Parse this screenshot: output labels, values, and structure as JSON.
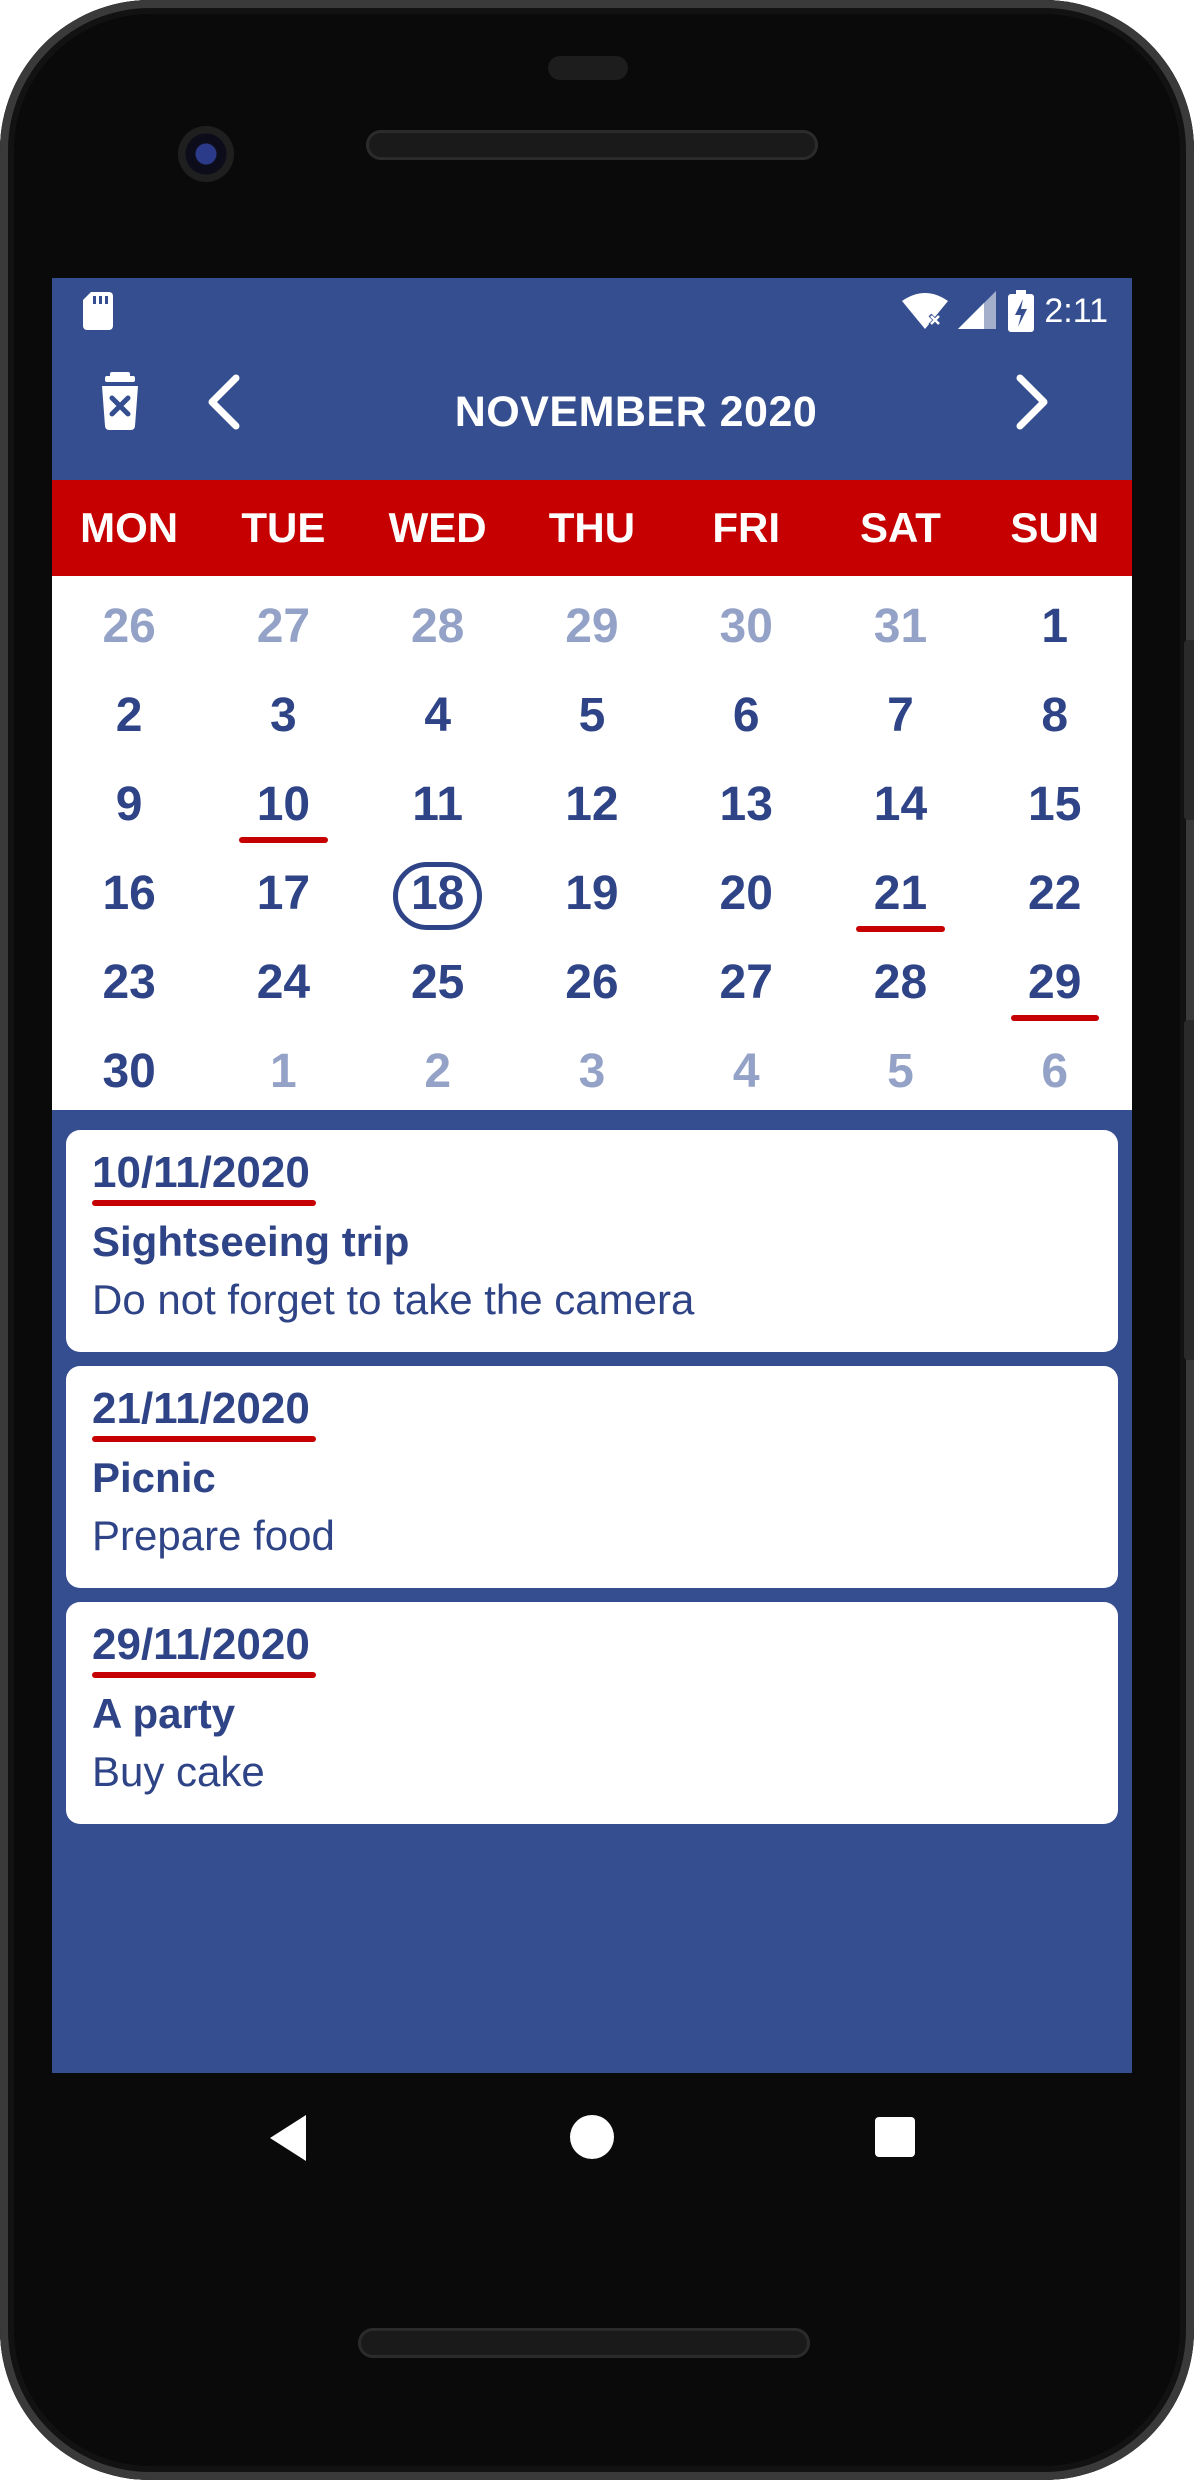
{
  "status_bar": {
    "time": "2:11",
    "icons": [
      "sd-card-icon",
      "wifi-icon",
      "signal-icon",
      "battery-charging-icon"
    ]
  },
  "app_bar": {
    "title": "NOVEMBER 2020",
    "icons": {
      "delete": "delete-icon",
      "prev": "chevron-left-icon",
      "next": "chevron-right-icon"
    }
  },
  "calendar": {
    "weekdays": [
      "MON",
      "TUE",
      "WED",
      "THU",
      "FRI",
      "SAT",
      "SUN"
    ],
    "weeks": [
      [
        {
          "day": "26",
          "other": true
        },
        {
          "day": "27",
          "other": true
        },
        {
          "day": "28",
          "other": true
        },
        {
          "day": "29",
          "other": true
        },
        {
          "day": "30",
          "other": true
        },
        {
          "day": "31",
          "other": true
        },
        {
          "day": "1"
        }
      ],
      [
        {
          "day": "2"
        },
        {
          "day": "3"
        },
        {
          "day": "4"
        },
        {
          "day": "5"
        },
        {
          "day": "6"
        },
        {
          "day": "7"
        },
        {
          "day": "8"
        }
      ],
      [
        {
          "day": "9"
        },
        {
          "day": "10",
          "event": true
        },
        {
          "day": "11"
        },
        {
          "day": "12"
        },
        {
          "day": "13"
        },
        {
          "day": "14"
        },
        {
          "day": "15"
        }
      ],
      [
        {
          "day": "16"
        },
        {
          "day": "17"
        },
        {
          "day": "18",
          "today": true
        },
        {
          "day": "19"
        },
        {
          "day": "20"
        },
        {
          "day": "21",
          "event": true
        },
        {
          "day": "22"
        }
      ],
      [
        {
          "day": "23"
        },
        {
          "day": "24"
        },
        {
          "day": "25"
        },
        {
          "day": "26"
        },
        {
          "day": "27"
        },
        {
          "day": "28"
        },
        {
          "day": "29",
          "event": true
        }
      ],
      [
        {
          "day": "30"
        },
        {
          "day": "1",
          "other": true
        },
        {
          "day": "2",
          "other": true
        },
        {
          "day": "3",
          "other": true
        },
        {
          "day": "4",
          "other": true
        },
        {
          "day": "5",
          "other": true
        },
        {
          "day": "6",
          "other": true
        }
      ]
    ]
  },
  "events": [
    {
      "date": "10/11/2020",
      "title": "Sightseeing trip",
      "description": "Do not forget to take the camera"
    },
    {
      "date": "21/11/2020",
      "title": "Picnic",
      "description": "Prepare food"
    },
    {
      "date": "29/11/2020",
      "title": "A party",
      "description": "Buy cake"
    }
  ],
  "nav_bar": {
    "icons": [
      "back-icon",
      "home-icon",
      "recents-icon"
    ]
  },
  "colors": {
    "primary": "#354e8f",
    "text_primary": "#2e4487",
    "muted_day": "#93a2c6",
    "accent_red": "#c60000",
    "surface": "#ffffff"
  }
}
